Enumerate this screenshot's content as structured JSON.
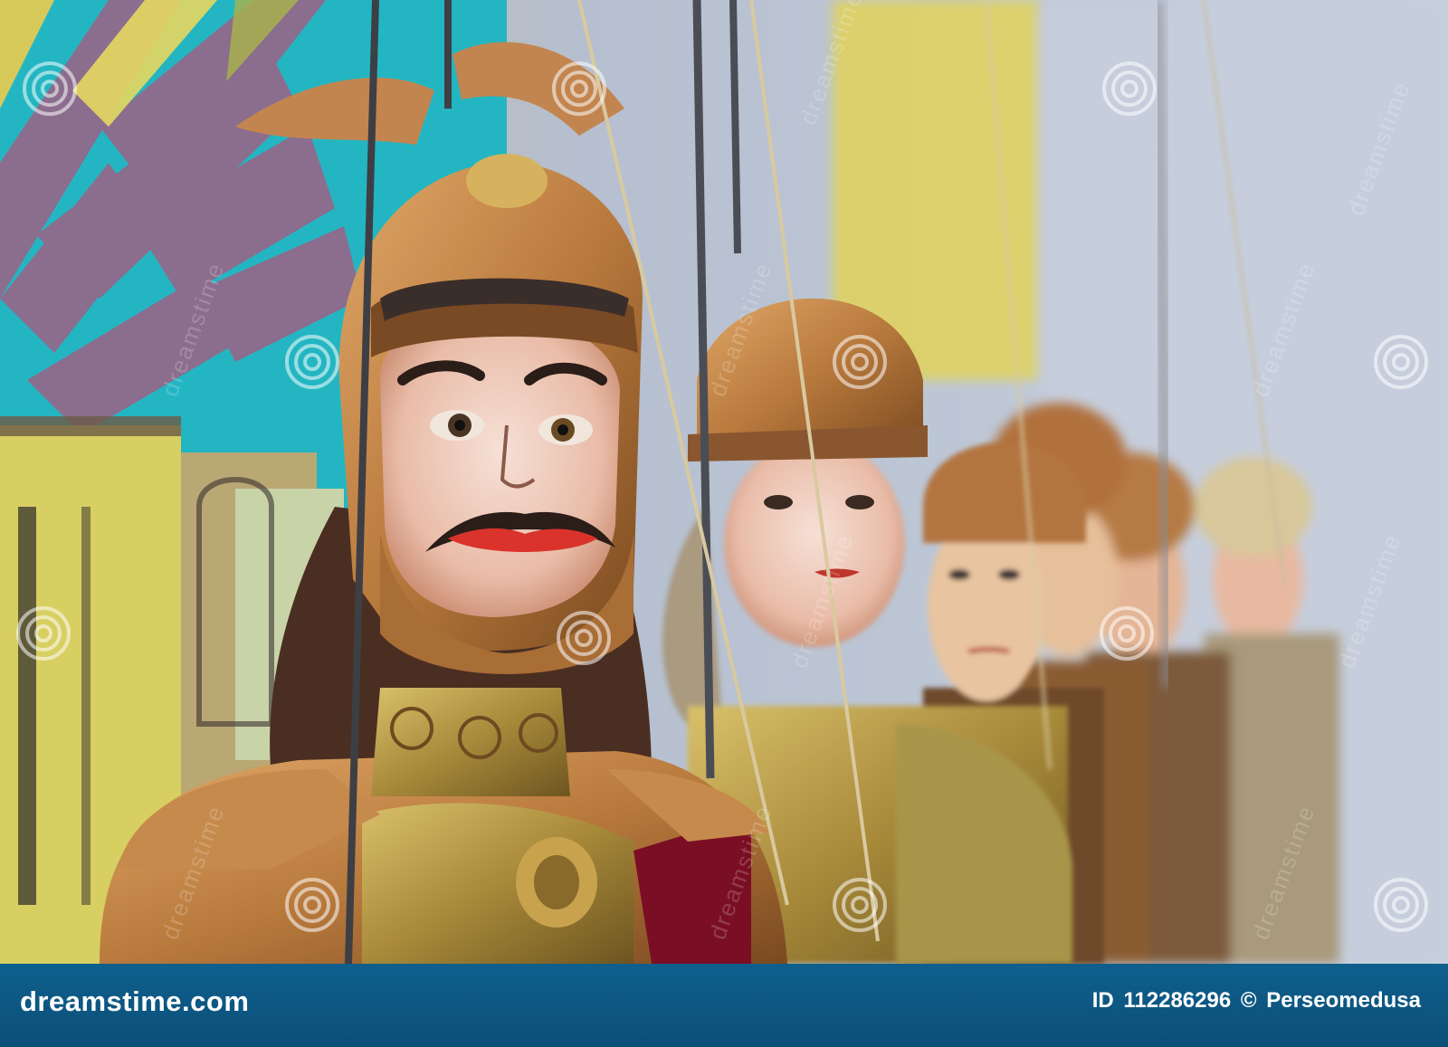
{
  "image": {
    "subject": "Sicilian opera dei pupi marionettes in armour",
    "colors": {
      "footer_bg": "#0f5f8d",
      "copper": "#b97a3d",
      "teal_backdrop": "#23b6c2",
      "purple_backdrop": "#8b6d8e",
      "yellow_backdrop": "#d8cf62"
    }
  },
  "footer": {
    "brand": "dreamstime.com",
    "id_label": "ID",
    "id_value": "112286296",
    "copyright_symbol": "©",
    "author": "Perseomedusa"
  },
  "watermark": {
    "text": "dreamstime",
    "icon": "spiral-logo-icon"
  }
}
